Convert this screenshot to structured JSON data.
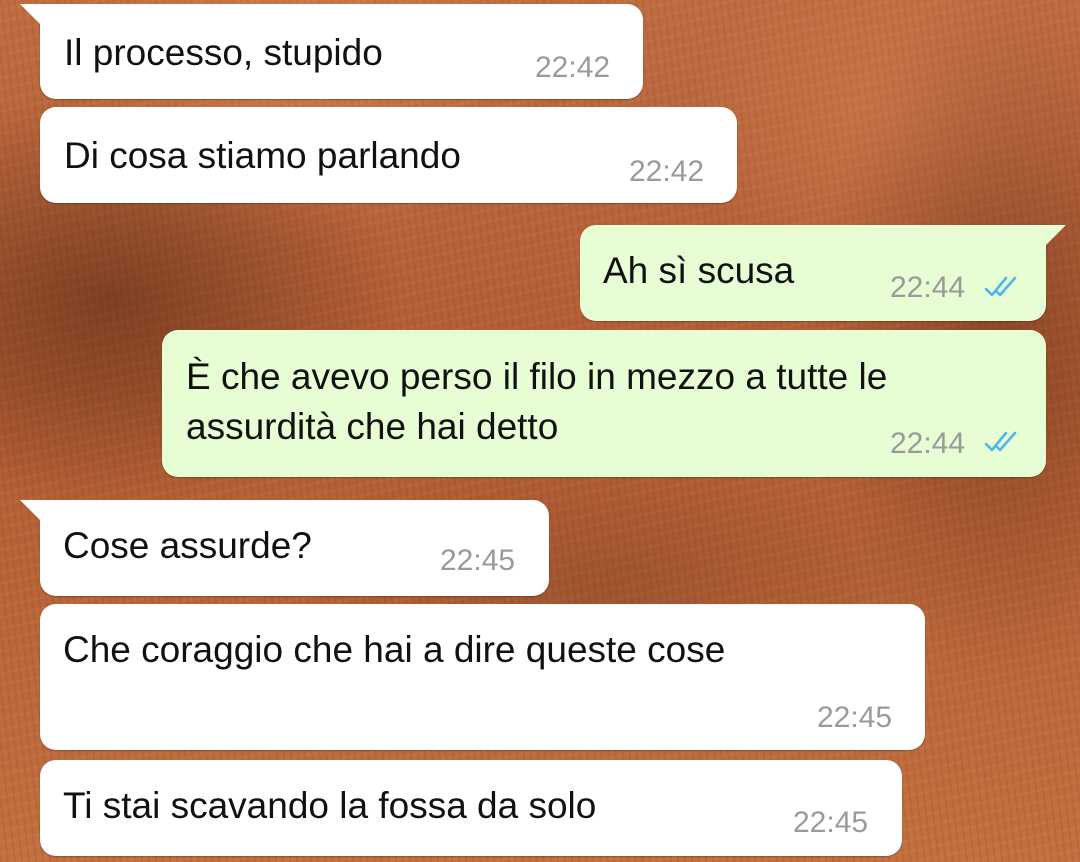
{
  "theme": {
    "incoming_bubble": "#ffffff",
    "outgoing_bubble": "#e7fdd3",
    "read_ticks_color": "#4fb6ec",
    "time_color": "#9a9a9a"
  },
  "messages": [
    {
      "direction": "incoming",
      "text": "Il processo, stupido",
      "time": "22:42"
    },
    {
      "direction": "incoming",
      "text": "Di cosa stiamo parlando",
      "time": "22:42"
    },
    {
      "direction": "outgoing",
      "text": "Ah sì scusa",
      "time": "22:44",
      "status": "read-double-check-icon"
    },
    {
      "direction": "outgoing",
      "text_lines": [
        "È che avevo perso il filo in mezzo a tutte le",
        "assurdità che hai detto"
      ],
      "time": "22:44",
      "status": "read-double-check-icon"
    },
    {
      "direction": "incoming",
      "text": "Cose assurde?",
      "time": "22:45"
    },
    {
      "direction": "incoming",
      "text": "Che coraggio che hai a dire queste cose",
      "time": "22:45"
    },
    {
      "direction": "incoming",
      "text": "Ti stai scavando la fossa da solo",
      "time": "22:45"
    }
  ]
}
